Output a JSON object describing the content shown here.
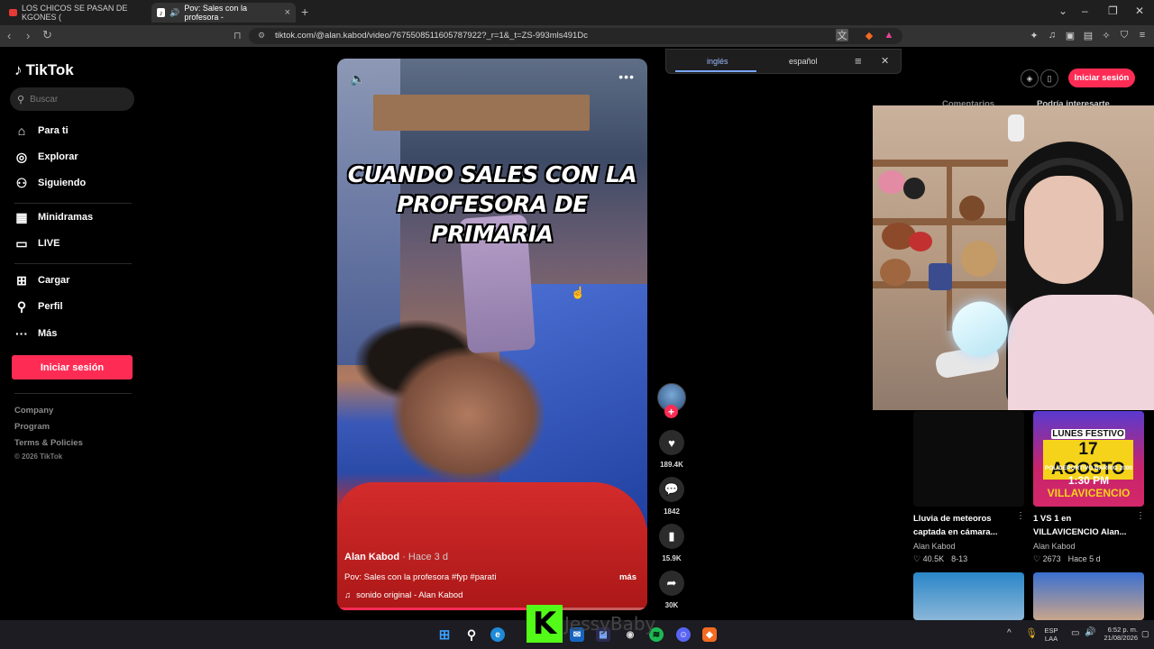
{
  "browser": {
    "tabs": [
      {
        "label": "LOS CHICOS SE PASAN DE KGONES (",
        "favicon": "youtube-icon"
      },
      {
        "label": "Pov: Sales con la profesora - ",
        "favicon": "tiktok-icon",
        "active": true
      }
    ],
    "url": "tiktok.com/@alan.kabod/video/7675508511605787922?_r=1&_t=ZS-993mls491Dc"
  },
  "translate_popup": {
    "source_lang": "inglés",
    "target_lang": "español"
  },
  "sidebar": {
    "logo": "TikTok",
    "search_placeholder": "Buscar",
    "nav": [
      {
        "label": "Para ti",
        "icon": "home-icon"
      },
      {
        "label": "Explorar",
        "icon": "compass-icon"
      },
      {
        "label": "Siguiendo",
        "icon": "following-icon"
      },
      {
        "label": "Minidramas",
        "icon": "minidramas-icon"
      },
      {
        "label": "LIVE",
        "icon": "live-icon"
      },
      {
        "label": "Cargar",
        "icon": "upload-icon"
      },
      {
        "label": "Perfil",
        "icon": "profile-icon"
      },
      {
        "label": "Más",
        "icon": "more-icon"
      }
    ],
    "login_label": "Iniciar sesión",
    "footer_links": [
      "Company",
      "Program",
      "Terms & Policies"
    ],
    "copyright": "© 2026 TikTok"
  },
  "video": {
    "caption": "CUANDO SALES CON LA PROFESORA DE PRIMARIA",
    "author": "Alan Kabod",
    "date": "· Hace 3 d",
    "description": "Pov: Sales con la profesora #fyp #parati",
    "more_label": "más",
    "sound": "sonido original - Alan Kabod",
    "progress": 0.62
  },
  "actions": {
    "likes": "189.4K",
    "comments": "1842",
    "saves": "15.9K",
    "shares": "30K"
  },
  "header_right": {
    "login_label": "Iniciar sesión",
    "tabs": [
      "Comentarios",
      "Podría interesarte"
    ]
  },
  "recommended": [
    {
      "title_line1": "Lluvia de meteoros",
      "title_line2": "captada en cámara...",
      "author": "Alan Kabod",
      "likes": "40.5K",
      "date": "8-13"
    },
    {
      "title_line1": "1 VS 1 en",
      "title_line2": "VILLAVICENCIO Alan...",
      "author": "Alan Kabod",
      "likes": "2673",
      "date": "Hace 5 d",
      "poster": {
        "top": "LUNES FESTIVO",
        "date": "17 AGOSTO",
        "venue": "POLIDEPORTIVO BARRIO 2000",
        "time": "1:30 PM",
        "city": "VILLAVICENCIO"
      }
    }
  ],
  "overlay": {
    "streamer_name": "JessyBaby"
  },
  "taskbar": {
    "lang_line1": "ESP",
    "lang_line2": "LAA",
    "time": "6:52 p. m.",
    "date": "21/08/2026"
  },
  "colors": {
    "accent": "#fe2c55",
    "background": "#000000",
    "kick_green": "#53fc18"
  }
}
